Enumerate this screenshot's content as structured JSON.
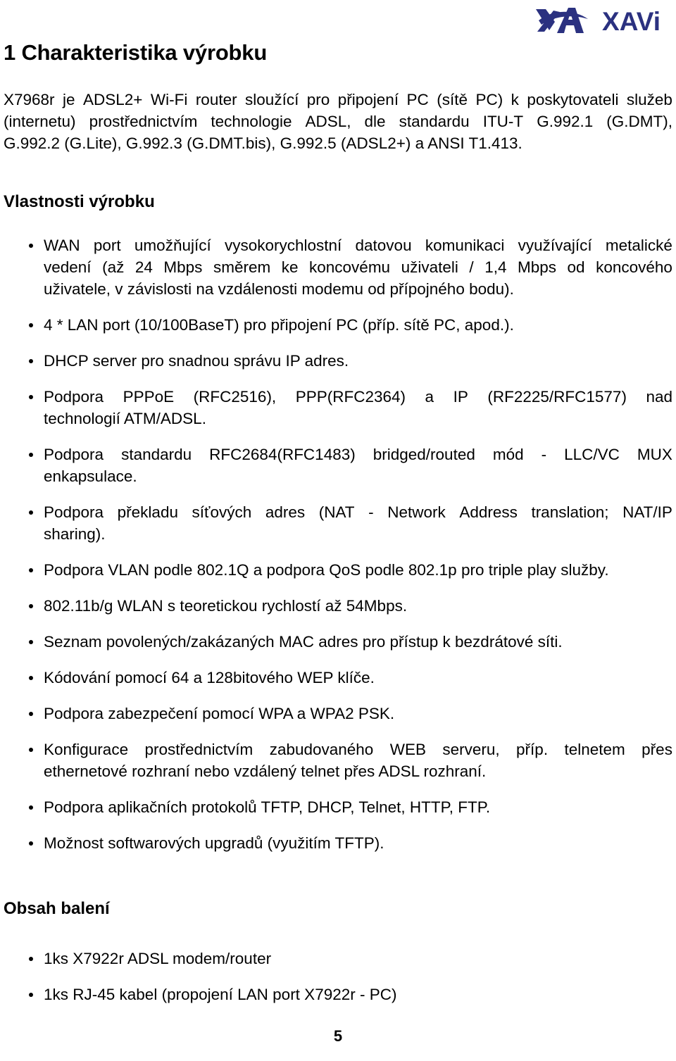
{
  "document": {
    "language": "cs",
    "page_number": "5",
    "text_color": "#000000",
    "background_color": "#ffffff"
  },
  "header": {
    "logo_name": "XAVi",
    "logo_text": "XAVi",
    "logo_color": "#2b3180"
  },
  "title": "1 Charakteristika výrobku",
  "intro": {
    "lines": [
      "X7968r je ADSL2+ Wi-Fi router sloužící pro připojení PC (sítě PC) k poskytovateli služeb",
      "(internetu) prostřednictvím technologie ADSL, dle standardu ITU-T G.992.1 (G.DMT),",
      "G.992.2 (G.Lite), G.992.3 (G.DMT.bis), G.992.5 (ADSL2+) a ANSI T1.413."
    ],
    "full_text": "X7968r je ADSL2+ Wi-Fi router sloužící pro připojení PC (sítě PC) k poskytovateli služeb (internetu) prostřednictvím technologie ADSL, dle standardu ITU-T G.992.1 (G.DMT), G.992.2 (G.Lite), G.992.3 (G.DMT.bis), G.992.5 (ADSL2+) a ANSI T1.413."
  },
  "features": {
    "heading": "Vlastnosti výrobku",
    "items": [
      {
        "lines": [
          "WAN port umožňující vysokorychlostní datovou komunikaci využívající metalické",
          "vedení (až 24 Mbps směrem ke koncovému uživateli / 1,4 Mbps od koncového",
          "uživatele, v závislosti na vzdálenosti modemu od přípojného bodu)."
        ],
        "full_text": "WAN port umožňující vysokorychlostní datovou komunikaci využívající metalické vedení (až 24 Mbps směrem ke koncovému uživateli / 1,4 Mbps od koncového uživatele, v závislosti na vzdálenosti modemu od přípojného bodu)."
      },
      {
        "lines": [
          "4 * LAN port (10/100BaseT) pro připojení PC (příp. sítě PC, apod.)."
        ],
        "full_text": "4 * LAN port (10/100BaseT) pro připojení PC (příp. sítě PC, apod.)."
      },
      {
        "lines": [
          "DHCP server pro snadnou správu IP adres."
        ],
        "full_text": "DHCP server pro snadnou správu IP adres."
      },
      {
        "lines": [
          "Podpora PPPoE (RFC2516), PPP(RFC2364) a IP (RF2225/RFC1577) nad",
          "technologií ATM/ADSL."
        ],
        "full_text": "Podpora PPPoE (RFC2516), PPP(RFC2364) a IP (RF2225/RFC1577) nad technologií ATM/ADSL."
      },
      {
        "lines": [
          "Podpora standardu RFC2684(RFC1483) bridged/routed mód - LLC/VC MUX",
          "enkapsulace."
        ],
        "full_text": "Podpora standardu RFC2684(RFC1483) bridged/routed mód - LLC/VC MUX enkapsulace."
      },
      {
        "lines": [
          "Podpora překladu síťových adres (NAT - Network Address translation; NAT/IP",
          "sharing)."
        ],
        "full_text": "Podpora překladu síťových adres (NAT - Network Address translation; NAT/IP sharing)."
      },
      {
        "lines": [
          "Podpora VLAN podle 802.1Q a podpora QoS podle 802.1p pro triple play služby."
        ],
        "full_text": "Podpora VLAN podle 802.1Q a podpora QoS podle 802.1p pro triple play služby."
      },
      {
        "lines": [
          "802.11b/g WLAN s teoretickou rychlostí až 54Mbps."
        ],
        "full_text": "802.11b/g WLAN s teoretickou rychlostí až 54Mbps."
      },
      {
        "lines": [
          "Seznam povolených/zakázaných MAC adres pro přístup k bezdrátové síti."
        ],
        "full_text": "Seznam povolených/zakázaných MAC adres pro přístup k bezdrátové síti."
      },
      {
        "lines": [
          "Kódování pomocí 64 a 128bitového WEP klíče."
        ],
        "full_text": "Kódování pomocí 64 a 128bitového WEP klíče."
      },
      {
        "lines": [
          "Podpora zabezpečení pomocí WPA a WPA2 PSK."
        ],
        "full_text": "Podpora zabezpečení pomocí WPA a WPA2 PSK."
      },
      {
        "lines": [
          "Konfigurace prostřednictvím zabudovaného WEB serveru, příp. telnetem přes",
          "ethernetové rozhraní nebo vzdálený telnet přes ADSL rozhraní."
        ],
        "full_text": "Konfigurace prostřednictvím zabudovaného WEB serveru, příp. telnetem přes ethernetové rozhraní nebo vzdálený telnet přes ADSL rozhraní."
      },
      {
        "lines": [
          "Podpora aplikačních protokolů TFTP, DHCP, Telnet, HTTP, FTP."
        ],
        "full_text": "Podpora aplikačních protokolů TFTP, DHCP, Telnet, HTTP, FTP."
      },
      {
        "lines": [
          "Možnost softwarových upgradů (využitím TFTP)."
        ],
        "full_text": "Možnost softwarových upgradů (využitím TFTP)."
      }
    ]
  },
  "contents": {
    "heading": "Obsah balení",
    "items": [
      {
        "lines": [
          "1ks X7922r ADSL modem/router"
        ],
        "full_text": "1ks X7922r ADSL modem/router"
      },
      {
        "lines": [
          "1ks RJ-45 kabel (propojení LAN port X7922r - PC)"
        ],
        "full_text": "1ks RJ-45 kabel (propojení LAN port X7922r - PC)"
      }
    ]
  },
  "footer": {
    "page_number": "5"
  }
}
